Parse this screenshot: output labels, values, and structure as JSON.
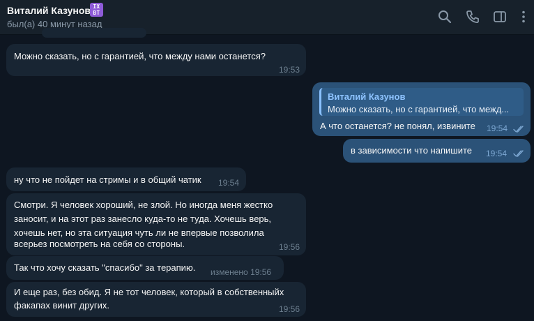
{
  "header": {
    "contact_name": "Виталий Казунов",
    "badge_text": "IX BT",
    "status": "был(а) 40 минут назад",
    "icons": [
      "search-icon",
      "phone-icon",
      "sidebar-toggle-icon",
      "more-icon"
    ]
  },
  "messages": [
    {
      "direction": "in",
      "text": "Можно сказать, но с гарантией, что между нами останется?",
      "time": "19:53"
    },
    {
      "direction": "out",
      "reply_to_name": "Виталий Казунов",
      "reply_to_text": "Можно сказать, но с гарантией, что межд...",
      "text": "А что останется? не понял, извините",
      "time": "19:54",
      "read": true
    },
    {
      "direction": "out",
      "text": "в зависимости что напишите",
      "time": "19:54",
      "read": true
    },
    {
      "direction": "in",
      "text": "ну что не пойдет на стримы и в общий чатик",
      "time": "19:54"
    },
    {
      "direction": "in",
      "text": "Смотри. Я человек хороший, не злой. Но иногда меня жестко заносит, и на этот раз занесло куда-то не туда. Хочешь верь, хочешь нет, но эта ситуация чуть ли не впервые позволила всерьез посмотреть на себя со стороны.",
      "lines": [
        "Смотри. Я человек хороший, не злой. Но иногда меня жестко",
        "заносит, и на этот раз занесло куда-то не туда. Хочешь верь,",
        "хочешь нет, но эта ситуация чуть ли не впервые позволила",
        "всерьез посмотреть на себя со стороны."
      ],
      "time": "19:56"
    },
    {
      "direction": "in",
      "text": "Так что хочу сказать \"спасибо\" за терапию.",
      "time": "изменено 19:56"
    },
    {
      "direction": "in",
      "text": "И еще раз, без обид. Я не тот человек, который в собственныйх факапах винит других.",
      "lines": [
        "И еще раз, без обид. Я не тот человек, который в собственныйх",
        "факапах винит других."
      ],
      "time": "19:56"
    }
  ],
  "colors": {
    "background": "#0e1621",
    "header": "#17212b",
    "incoming_bubble": "#182533",
    "outgoing_bubble": "#2b5278",
    "reply_accent": "#8ac1ff",
    "badge": "#8e5bd8"
  }
}
